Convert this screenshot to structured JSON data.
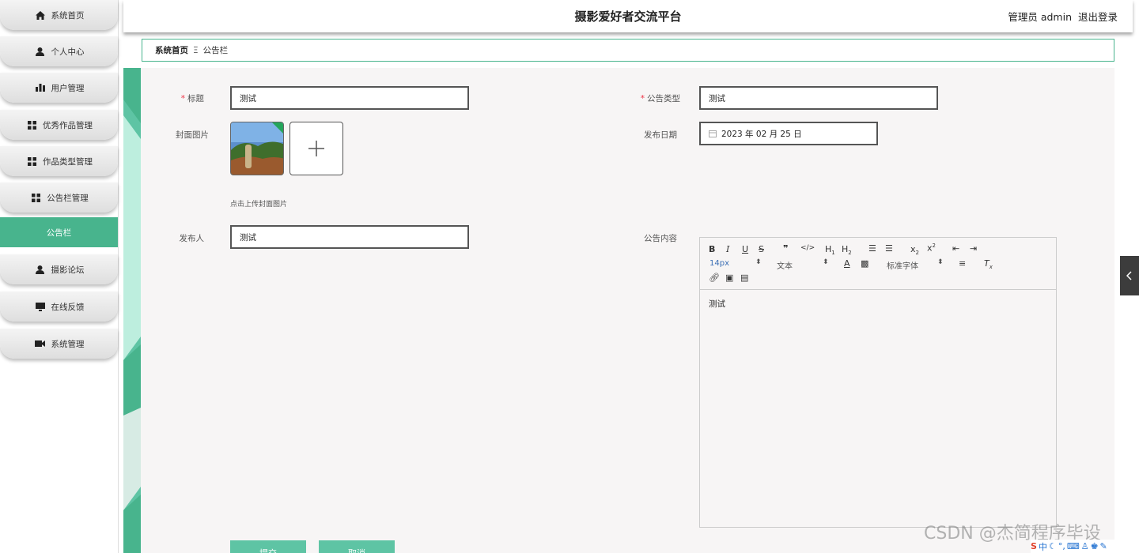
{
  "app": {
    "title": "摄影爱好者交流平台",
    "user_label": "管理员 admin",
    "logout_label": "退出登录"
  },
  "sidebar": {
    "items": [
      {
        "label": "系统首页",
        "icon": "home-icon"
      },
      {
        "label": "个人中心",
        "icon": "user-icon"
      },
      {
        "label": "用户管理",
        "icon": "bar-chart-icon"
      },
      {
        "label": "优秀作品管理",
        "icon": "grid-icon"
      },
      {
        "label": "作品类型管理",
        "icon": "grid-icon"
      },
      {
        "label": "公告栏管理",
        "icon": "grid-icon"
      },
      {
        "label": "公告栏",
        "icon": "",
        "active": true
      },
      {
        "label": "摄影论坛",
        "icon": "user-icon"
      },
      {
        "label": "在线反馈",
        "icon": "monitor-icon"
      },
      {
        "label": "系统管理",
        "icon": "camera-icon"
      }
    ]
  },
  "breadcrumb": {
    "home": "系统首页",
    "separator": "Ξ",
    "current": "公告栏"
  },
  "form": {
    "title_label": "标题",
    "title_value": "测试",
    "type_label": "公告类型",
    "type_value": "测试",
    "cover_label": "封面图片",
    "cover_hint": "点击上传封面图片",
    "date_label": "发布日期",
    "date_value": "2023 年 02 月 25 日",
    "publisher_label": "发布人",
    "publisher_value": "测试",
    "content_label": "公告内容",
    "content_value": "测试",
    "submit_label": "提交",
    "cancel_label": "取消"
  },
  "editor": {
    "font_size": "14px",
    "block_type": "文本",
    "font_family": "标准字体"
  },
  "watermark": "CSDN @杰简程序毕设",
  "colors": {
    "accent": "#48b48d",
    "button": "#5ec4a4",
    "panel": "#f7f5f5"
  }
}
